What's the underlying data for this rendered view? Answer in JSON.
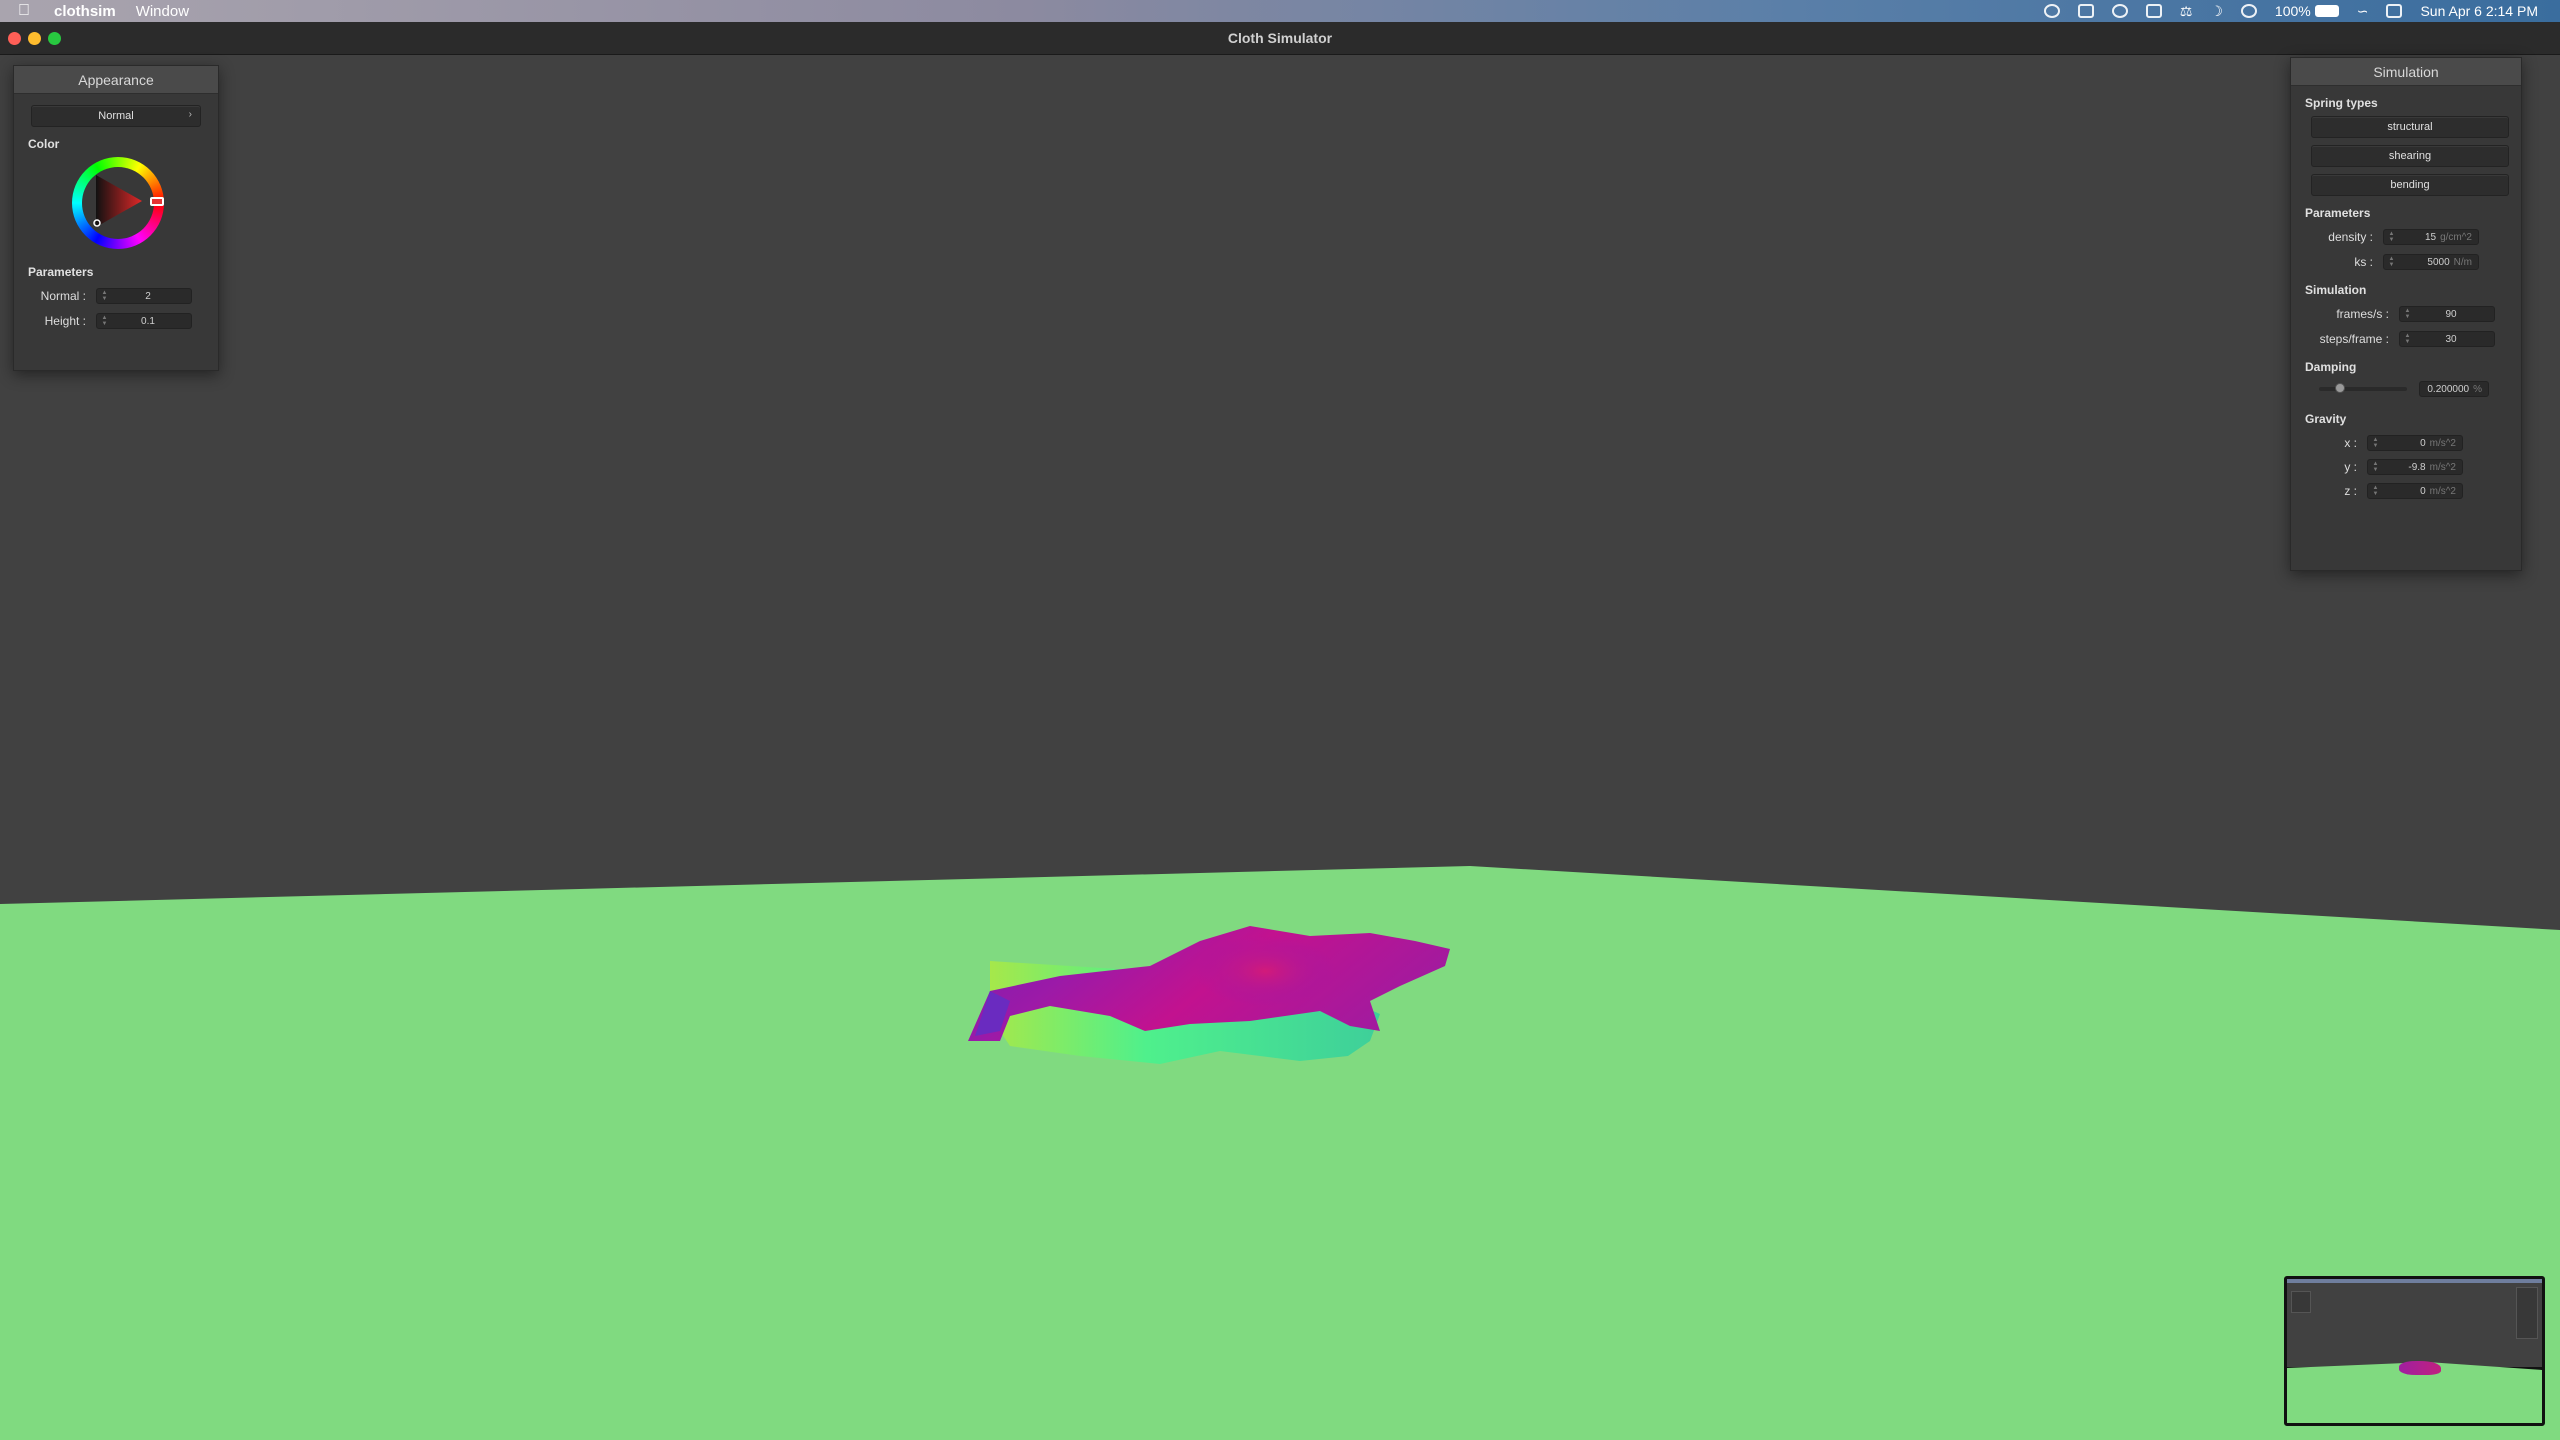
{
  "menubar": {
    "app_name": "clothsim",
    "menus": [
      "Window"
    ],
    "battery_pct": "100%",
    "clock": "Sun Apr 6  2:14 PM"
  },
  "window": {
    "title": "Cloth Simulator"
  },
  "appearance": {
    "title": "Appearance",
    "shader": "Normal",
    "color_label": "Color",
    "params_label": "Parameters",
    "normal_label": "Normal :",
    "normal_value": "2",
    "height_label": "Height :",
    "height_value": "0.1"
  },
  "simulation": {
    "title": "Simulation",
    "spring_types_label": "Spring types",
    "spring_types": [
      "structural",
      "shearing",
      "bending"
    ],
    "parameters_label": "Parameters",
    "density_label": "density :",
    "density_value": "15",
    "density_unit": "g/cm^2",
    "ks_label": "ks :",
    "ks_value": "5000",
    "ks_unit": "N/m",
    "simulation_label": "Simulation",
    "fps_label": "frames/s :",
    "fps_value": "90",
    "steps_label": "steps/frame :",
    "steps_value": "30",
    "damping_label": "Damping",
    "damping_value": "0.200000",
    "damping_unit": "%",
    "damping_level": 0.2,
    "gravity_label": "Gravity",
    "gx_label": "x :",
    "gx_value": "0",
    "gy_label": "y :",
    "gy_value": "-9.8",
    "gz_label": "z :",
    "gz_value": "0",
    "gravity_unit": "m/s^2"
  },
  "colors": {
    "background": "#414141",
    "ground": "#80da80",
    "cloth_top": "#b5169a",
    "cloth_edge": "#4fe87a"
  },
  "icons": [
    "apple-icon",
    "wifi-icon",
    "battery-icon",
    "control-center-icon",
    "moon-icon",
    "color-wheel-icon"
  ]
}
